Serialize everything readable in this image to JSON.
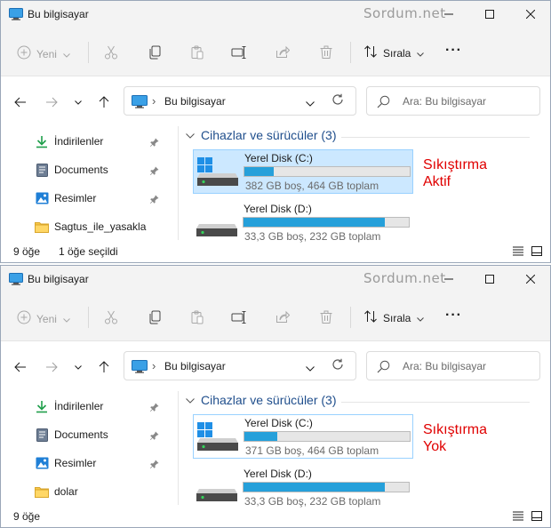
{
  "watermark": "Sordum.net",
  "windows": [
    {
      "title": "Bu bilgisayar",
      "toolbar": {
        "new_label": "Yeni",
        "sort_label": "Sırala",
        "more_label": "···"
      },
      "address": {
        "path": "Bu bilgisayar"
      },
      "search": {
        "placeholder": "Ara: Bu bilgisayar"
      },
      "sidebar": [
        {
          "label": "İndirilenler",
          "icon": "download-icon"
        },
        {
          "label": "Documents",
          "icon": "documents-icon"
        },
        {
          "label": "Resimler",
          "icon": "pictures-icon"
        },
        {
          "label": "Sagtus_ile_yasakla",
          "icon": "folder-icon"
        }
      ],
      "group_label": "Cihazlar ve sürücüler (3)",
      "drives": [
        {
          "name": "Yerel Disk (C:)",
          "capacity": "382 GB boş, 464 GB toplam",
          "used_fraction": 0.177
        },
        {
          "name": "Yerel Disk (D:)",
          "capacity": "33,3 GB boş, 232 GB toplam",
          "used_fraction": 0.856
        }
      ],
      "annotation": [
        "Sıkıştırma",
        "Aktif"
      ],
      "status": {
        "count": "9 öğe",
        "selected": "1 öğe seçildi"
      }
    },
    {
      "title": "Bu bilgisayar",
      "toolbar": {
        "new_label": "Yeni",
        "sort_label": "Sırala",
        "more_label": "···"
      },
      "address": {
        "path": "Bu bilgisayar"
      },
      "search": {
        "placeholder": "Ara: Bu bilgisayar"
      },
      "sidebar": [
        {
          "label": "İndirilenler",
          "icon": "download-icon"
        },
        {
          "label": "Documents",
          "icon": "documents-icon"
        },
        {
          "label": "Resimler",
          "icon": "pictures-icon"
        },
        {
          "label": "dolar",
          "icon": "folder-icon"
        }
      ],
      "group_label": "Cihazlar ve sürücüler (3)",
      "drives": [
        {
          "name": "Yerel Disk (C:)",
          "capacity": "371 GB boş, 464 GB toplam",
          "used_fraction": 0.2
        },
        {
          "name": "Yerel Disk (D:)",
          "capacity": "33,3 GB boş, 232 GB toplam",
          "used_fraction": 0.856
        }
      ],
      "annotation": [
        "Sıkıştırma",
        "Yok"
      ],
      "status": {
        "count": "9 öğe",
        "selected": ""
      }
    }
  ],
  "colors": {
    "accent": "#26a0da",
    "selection": "#cce8ff",
    "annotation": "#e00000",
    "group_heading": "#1f4e8c"
  }
}
